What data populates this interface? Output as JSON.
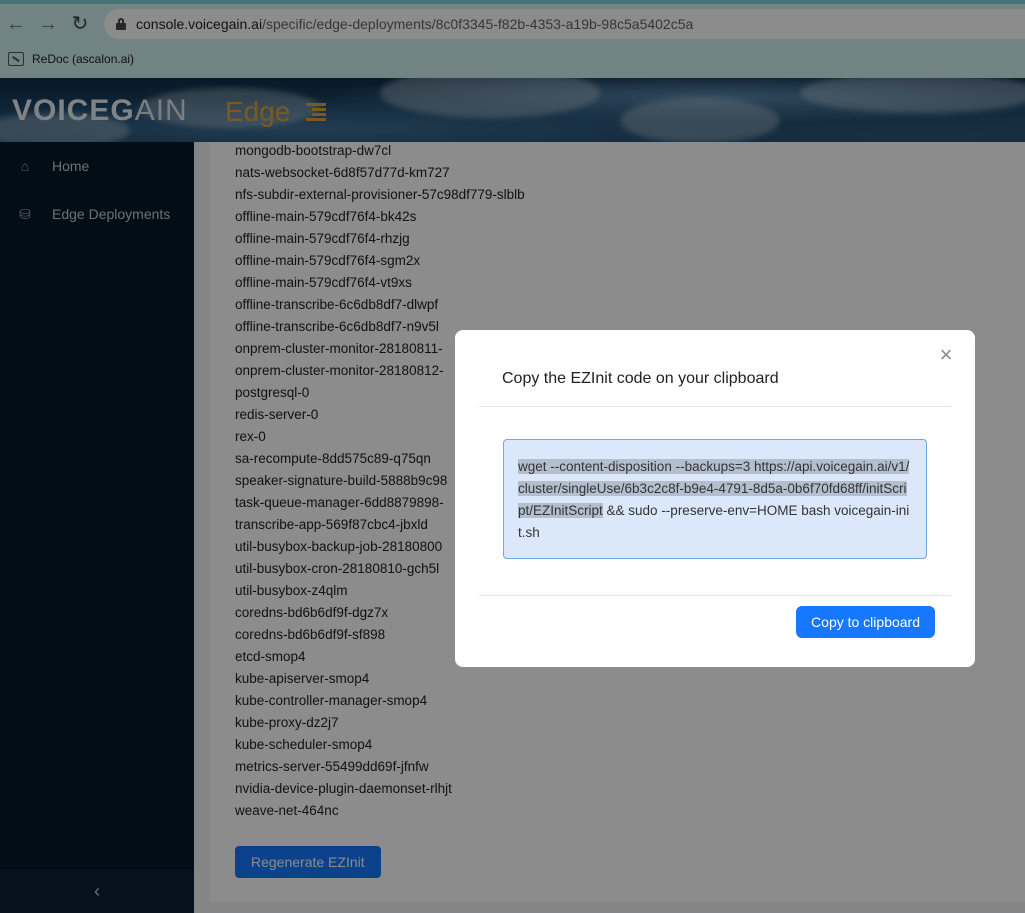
{
  "browser": {
    "url_host": "console.voicegain.ai",
    "url_path": "/specific/edge-deployments/8c0f3345-f82b-4353-a19b-98c5a5402c5a",
    "bookmark_label": "ReDoc (ascalon.ai)"
  },
  "header": {
    "logo_bold": "VOICEG",
    "logo_thin": "AIN",
    "product": "Edge"
  },
  "sidebar": {
    "items": [
      {
        "label": "Home",
        "icon": "home-icon"
      },
      {
        "label": "Edge Deployments",
        "icon": "network-icon"
      }
    ],
    "collapse_label": "‹"
  },
  "pods": [
    "mongodb-bootstrap-dw7cl",
    "nats-websocket-6d8f57d77d-km727",
    "nfs-subdir-external-provisioner-57c98df779-slblb",
    "offline-main-579cdf76f4-bk42s",
    "offline-main-579cdf76f4-rhzjg",
    "offline-main-579cdf76f4-sgm2x",
    "offline-main-579cdf76f4-vt9xs",
    "offline-transcribe-6c6db8df7-dlwpf",
    "offline-transcribe-6c6db8df7-n9v5l",
    "onprem-cluster-monitor-28180811-",
    "onprem-cluster-monitor-28180812-",
    "postgresql-0",
    "redis-server-0",
    "rex-0",
    "sa-recompute-8dd575c89-q75qn",
    "speaker-signature-build-5888b9c98",
    "task-queue-manager-6dd8879898-",
    "transcribe-app-569f87cbc4-jbxld",
    "util-busybox-backup-job-28180800",
    "util-busybox-cron-28180810-gch5l",
    "util-busybox-z4qlm",
    "coredns-bd6b6df9f-dgz7x",
    "coredns-bd6b6df9f-sf898",
    "etcd-smop4",
    "kube-apiserver-smop4",
    "kube-controller-manager-smop4",
    "kube-proxy-dz2j7",
    "kube-scheduler-smop4",
    "metrics-server-55499dd69f-jfnfw",
    "nvidia-device-plugin-daemonset-rlhjt",
    "weave-net-464nc"
  ],
  "regenerate_label": "Regenerate EZInit",
  "modal": {
    "title": "Copy the EZInit code on your clipboard",
    "code_selected": "wget --content-disposition --backups=3 https://api.voicegain.ai/v1/cluster/singleUse/6b3c2c8f-b9e4-4791-8d5a-0b6f70fd68ff/initScript/EZInitScript",
    "code_rest": " && sudo --preserve-env=HOME bash voicegain-init.sh",
    "copy_label": "Copy to clipboard",
    "close_label": "×"
  },
  "colors": {
    "primary": "#1677ff",
    "sidebar_bg": "#041829",
    "brand_orange": "#e0a43a"
  }
}
